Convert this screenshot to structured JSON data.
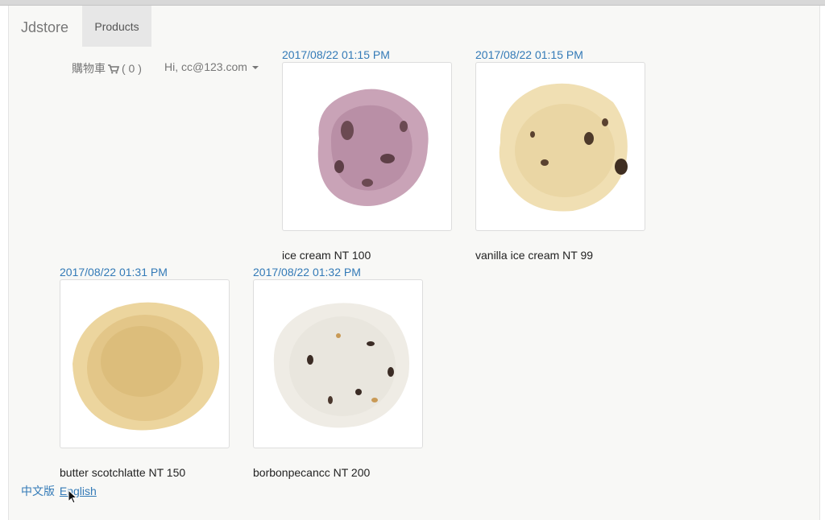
{
  "navbar": {
    "brand": "Jdstore",
    "active_tab": "Products"
  },
  "header": {
    "cart_label": "購物車",
    "cart_count": "( 0 )",
    "user_greeting": "Hi, cc@123.com"
  },
  "products": [
    {
      "timestamp": "2017/08/22 01:15 PM",
      "name": "ice cream NT 100",
      "image": "berry-ice-cream-scoop"
    },
    {
      "timestamp": "2017/08/22 01:15 PM",
      "name": "vanilla ice cream NT 99",
      "image": "vanilla-ice-cream-scoop"
    },
    {
      "timestamp": "2017/08/22 01:31 PM",
      "name": "butter scotchlatte NT 150",
      "image": "butterscotch-ice-cream-scoop"
    },
    {
      "timestamp": "2017/08/22 01:32 PM",
      "name": "borbonpecancc NT 200",
      "image": "pecan-ice-cream-scoop"
    }
  ],
  "footer": {
    "lang_zh": "中文版",
    "lang_en": "English"
  },
  "colors": {
    "link": "#337ab7",
    "berry": "#b98fa6",
    "vanilla": "#ead6a4",
    "butterscotch": "#e3c688",
    "pecan": "#e9e6de"
  }
}
